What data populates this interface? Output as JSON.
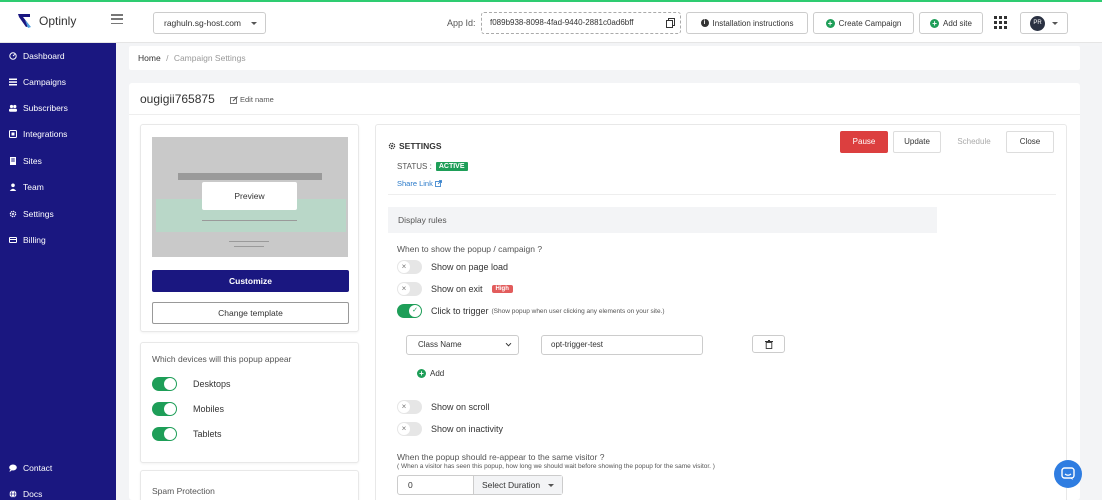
{
  "brand": {
    "name": "Optinly"
  },
  "topbar": {
    "site": "raghuln.sg-host.com",
    "app_id_label": "App Id:",
    "app_id": "f089b938-8098-4fad-9440-2881c0ad6bff",
    "installation_label": "Installation instructions",
    "create_campaign_label": "Create Campaign",
    "add_site_label": "Add site",
    "avatar_initials": "PR"
  },
  "sidebar": {
    "items": [
      {
        "label": "Dashboard",
        "icon": "gauge-icon"
      },
      {
        "label": "Campaigns",
        "icon": "list-icon"
      },
      {
        "label": "Subscribers",
        "icon": "users-icon"
      },
      {
        "label": "Integrations",
        "icon": "plug-icon"
      },
      {
        "label": "Sites",
        "icon": "sites-icon"
      },
      {
        "label": "Team",
        "icon": "user-icon"
      },
      {
        "label": "Settings",
        "icon": "gear-icon"
      },
      {
        "label": "Billing",
        "icon": "card-icon"
      }
    ],
    "bottom": [
      {
        "label": "Contact",
        "icon": "chat-icon"
      },
      {
        "label": "Docs",
        "icon": "globe-icon"
      }
    ]
  },
  "breadcrumb": {
    "home": "Home",
    "separator": "/",
    "current": "Campaign Settings"
  },
  "campaign": {
    "name": "ougigii765875",
    "edit_label": "Edit name"
  },
  "preview": {
    "preview_label": "Preview",
    "customize_label": "Customize",
    "change_template_label": "Change template"
  },
  "devices": {
    "title": "Which devices will this popup appear",
    "items": [
      {
        "label": "Desktops",
        "on": true
      },
      {
        "label": "Mobiles",
        "on": true
      },
      {
        "label": "Tablets",
        "on": true
      }
    ]
  },
  "spam": {
    "title": "Spam Protection"
  },
  "settings": {
    "title": "SETTINGS",
    "pause_label": "Pause",
    "update_label": "Update",
    "schedule_label": "Schedule",
    "close_label": "Close",
    "status_label": "STATUS :",
    "status_value": "ACTIVE",
    "share_link_label": "Share Link",
    "display_rules_label": "Display rules",
    "when_show_label": "When to show the popup / campaign ?",
    "options": {
      "page_load": "Show on page load",
      "exit": "Show on exit",
      "exit_badge": "High",
      "click_trigger": "Click to trigger",
      "click_trigger_note": "(Show popup when user clicking any elements on your site.)",
      "scroll": "Show on scroll",
      "inactivity": "Show on inactivity"
    },
    "trigger": {
      "selector_type": "Class Name",
      "selector_value": "opt-trigger-test",
      "add_label": "Add"
    },
    "reappear_label": "When the popup should re-appear to the same visitor ?",
    "reappear_sub": "( When a visitor has seen this popup, how long we should wait before showing the popup for the same visitor. )",
    "duration_value": "0",
    "duration_select": "Select Duration"
  },
  "colors": {
    "primary": "#1a1780",
    "success": "#1e9e58",
    "danger": "#dc3f3f",
    "accent_top": "#2ecc71",
    "chat": "#2f7de1"
  }
}
